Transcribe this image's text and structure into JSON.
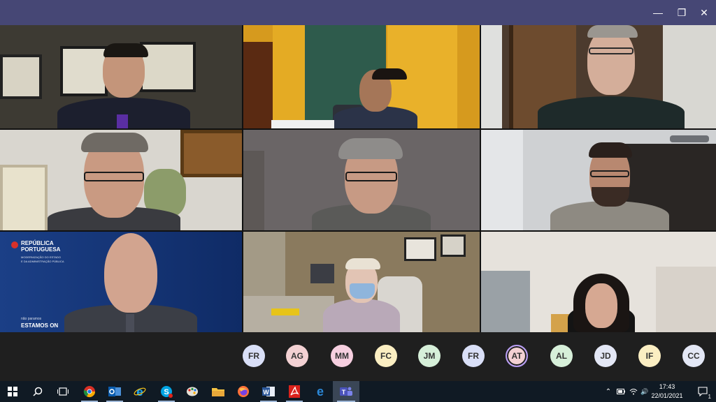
{
  "window": {
    "controls": {
      "minimize": "—",
      "restore": "❐",
      "close": "✕"
    }
  },
  "tiles": [
    {
      "id": "tile-1",
      "colors": {
        "bg": "#3d3a33",
        "shirt": "#1c1f2e",
        "skin": "#c4957a"
      }
    },
    {
      "id": "tile-2",
      "colors": {
        "bg": "#d69a1e",
        "shirt": "#2b3348",
        "skin": "#a57658"
      }
    },
    {
      "id": "tile-3",
      "colors": {
        "bg": "#4c3b2e",
        "shirt": "#1e2a2a",
        "skin": "#d4ae9a"
      }
    },
    {
      "id": "tile-4",
      "colors": {
        "bg": "#d9d6cf",
        "shirt": "#3a3b40",
        "skin": "#c99a82"
      }
    },
    {
      "id": "tile-5",
      "colors": {
        "bg": "#6a6566",
        "shirt": "#5a5a58",
        "skin": "#c79a84"
      }
    },
    {
      "id": "tile-6",
      "colors": {
        "bg": "#cfd1d3",
        "shirt": "#8e8a82",
        "skin": "#b88870"
      }
    },
    {
      "id": "tile-7",
      "colors": {
        "bg": "#163a80",
        "shirt": "#3b3e46",
        "skin": "#d2a48f"
      },
      "background_text": {
        "brand_line_1": "REPÚBLICA",
        "brand_line_2": "PORTUGUESA",
        "ministry_line_1": "MODERNIZAÇÃO DO ESTADO",
        "ministry_line_2": "E DA ADMINISTRAÇÃO PÚBLICA",
        "slogan_small": "não paramos",
        "slogan_big": "ESTAMOS ON"
      }
    },
    {
      "id": "tile-8",
      "colors": {
        "bg": "#8a7a5e",
        "shirt": "#b9a9b8",
        "skin": "#e2c4b4"
      }
    },
    {
      "id": "tile-9",
      "colors": {
        "bg": "#e6e2dc",
        "shirt": "#141414",
        "skin": "#d6a892"
      }
    }
  ],
  "participants": [
    {
      "initials": "FR",
      "color": "#d9dff7",
      "active": false
    },
    {
      "initials": "AG",
      "color": "#f3d1d3",
      "active": false
    },
    {
      "initials": "MM",
      "color": "#f6cfe0",
      "active": false
    },
    {
      "initials": "FC",
      "color": "#fbeec2",
      "active": false
    },
    {
      "initials": "JM",
      "color": "#d6efd9",
      "active": false
    },
    {
      "initials": "FR",
      "color": "#d9dff7",
      "active": false
    },
    {
      "initials": "AT",
      "color": "#f3d1d3",
      "active": true
    },
    {
      "initials": "AL",
      "color": "#d6efd9",
      "active": false
    },
    {
      "initials": "JD",
      "color": "#e3e7f5",
      "active": false
    },
    {
      "initials": "IF",
      "color": "#fbeec2",
      "active": false
    },
    {
      "initials": "CC",
      "color": "#e3e7f5",
      "active": false
    }
  ],
  "taskbar": {
    "icons": [
      {
        "name": "windows-start-icon",
        "active": false,
        "running": false
      },
      {
        "name": "search-icon",
        "active": false,
        "running": false
      },
      {
        "name": "task-view-icon",
        "active": false,
        "running": false
      },
      {
        "name": "chrome-icon",
        "active": false,
        "running": true
      },
      {
        "name": "outlook-icon",
        "active": false,
        "running": true
      },
      {
        "name": "internet-explorer-icon",
        "active": false,
        "running": false
      },
      {
        "name": "skype-icon",
        "active": false,
        "running": true
      },
      {
        "name": "paint-icon",
        "active": false,
        "running": false
      },
      {
        "name": "file-explorer-icon",
        "active": false,
        "running": false
      },
      {
        "name": "firefox-icon",
        "active": false,
        "running": false
      },
      {
        "name": "word-icon",
        "active": false,
        "running": true
      },
      {
        "name": "acrobat-icon",
        "active": false,
        "running": true
      },
      {
        "name": "edge-icon",
        "active": false,
        "running": false
      },
      {
        "name": "teams-icon",
        "active": true,
        "running": true
      }
    ],
    "time": "17:43",
    "date": "22/01/2021",
    "notifications_count": "1",
    "tray": {
      "chevron": "⌃",
      "volume": "🔊"
    }
  }
}
